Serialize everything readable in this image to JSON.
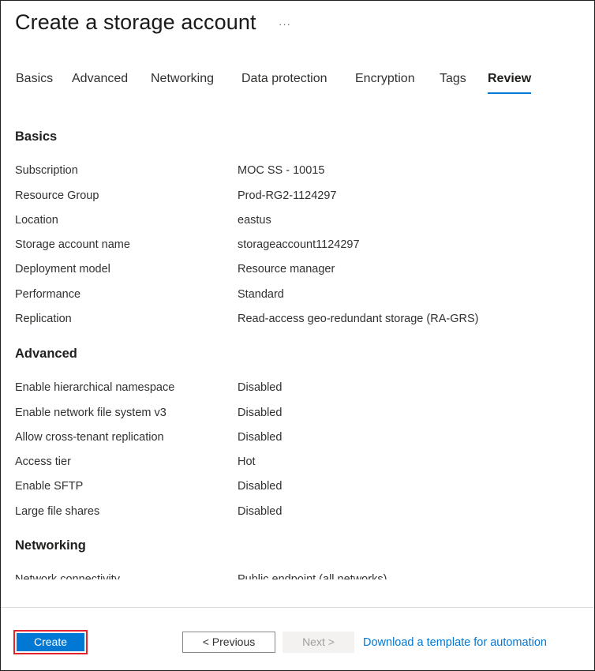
{
  "header": {
    "title": "Create a storage account",
    "more_label": "···"
  },
  "tabs": [
    {
      "label": "Basics"
    },
    {
      "label": "Advanced"
    },
    {
      "label": "Networking"
    },
    {
      "label": "Data protection"
    },
    {
      "label": "Encryption"
    },
    {
      "label": "Tags"
    },
    {
      "label": "Review",
      "active": true
    }
  ],
  "sections": {
    "basics": {
      "title": "Basics",
      "rows": [
        {
          "label": "Subscription",
          "value": "MOC SS - 10015"
        },
        {
          "label": "Resource Group",
          "value": "Prod-RG2-1124297"
        },
        {
          "label": "Location",
          "value": "eastus"
        },
        {
          "label": "Storage account name",
          "value": "storageaccount1124297"
        },
        {
          "label": "Deployment model",
          "value": "Resource manager"
        },
        {
          "label": "Performance",
          "value": "Standard"
        },
        {
          "label": "Replication",
          "value": "Read-access geo-redundant storage (RA-GRS)"
        }
      ]
    },
    "advanced": {
      "title": "Advanced",
      "rows": [
        {
          "label": "Enable hierarchical namespace",
          "value": "Disabled"
        },
        {
          "label": "Enable network file system v3",
          "value": "Disabled"
        },
        {
          "label": "Allow cross-tenant replication",
          "value": "Disabled"
        },
        {
          "label": "Access tier",
          "value": "Hot"
        },
        {
          "label": "Enable SFTP",
          "value": "Disabled"
        },
        {
          "label": "Large file shares",
          "value": "Disabled"
        }
      ]
    },
    "networking": {
      "title": "Networking",
      "rows": [
        {
          "label": "Network connectivity",
          "value": "Public endpoint (all networks)"
        }
      ]
    }
  },
  "footer": {
    "create_label": "Create",
    "previous_label": "< Previous",
    "next_label": "Next >",
    "template_link": "Download a template for automation"
  },
  "colors": {
    "accent": "#0078d4",
    "highlight_border": "#e3242b"
  }
}
